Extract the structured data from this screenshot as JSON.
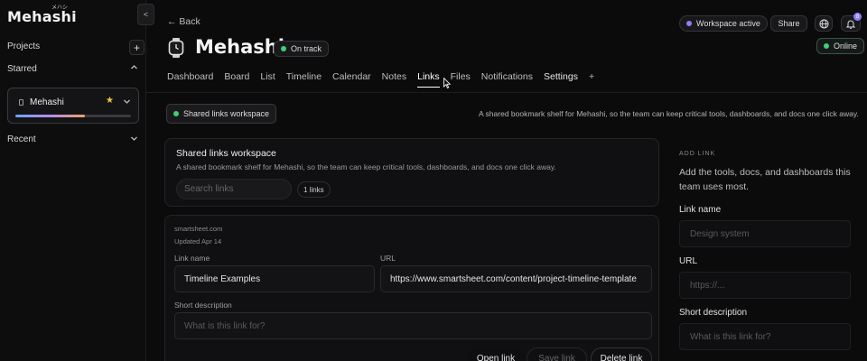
{
  "sidebar": {
    "logo": "Mehashi",
    "logo_kana": "メハシ",
    "collapse_glyph": "<",
    "projects_label": "Projects",
    "add_glyph": "+",
    "starred_label": "Starred",
    "starred_project": {
      "name": "Mehashi",
      "progress_percent": 60
    },
    "recent_label": "Recent"
  },
  "header": {
    "back_label": "← Back",
    "title": "Mehashi",
    "status": "On track",
    "workspace_status": "Workspace active",
    "share_label": "Share",
    "notification_count": "8",
    "connection_status": "Online"
  },
  "tabs": [
    "Dashboard",
    "Board",
    "List",
    "Timeline",
    "Calendar",
    "Notes",
    "Links",
    "Files",
    "Notifications",
    "Settings",
    "+"
  ],
  "active_tab": "Links",
  "links_page": {
    "chip_label": "Shared links workspace",
    "description": "A shared bookmark shelf for Mehashi, so the team can keep critical tools, dashboards, and docs one click away.",
    "card_title": "Shared links workspace",
    "card_description": "A shared bookmark shelf for Mehashi, so the team can keep critical tools, dashboards, and docs one click away.",
    "search_placeholder": "Search links",
    "count_label": "1 links",
    "link_item": {
      "domain": "smartsheet.com",
      "updated": "Updated Apr 14",
      "link_name_label": "Link name",
      "link_name_value": "Timeline Examples",
      "url_label": "URL",
      "url_value": "https://www.smartsheet.com/content/project-timeline-template",
      "short_desc_label": "Short description",
      "short_desc_placeholder": "What is this link for?",
      "open_label": "Open link",
      "save_label": "Save link",
      "delete_label": "Delete link"
    }
  },
  "add_link": {
    "heading": "ADD LINK",
    "intro": "Add the tools, docs, and dashboards this team uses most.",
    "name_label": "Link name",
    "name_placeholder": "Design system",
    "url_label": "URL",
    "url_placeholder": "https://...",
    "desc_label": "Short description",
    "desc_placeholder": "What is this link for?"
  },
  "colors": {
    "accent_green": "#3ecf7a",
    "accent_purple": "#8b80ff",
    "star": "#f5c542"
  }
}
